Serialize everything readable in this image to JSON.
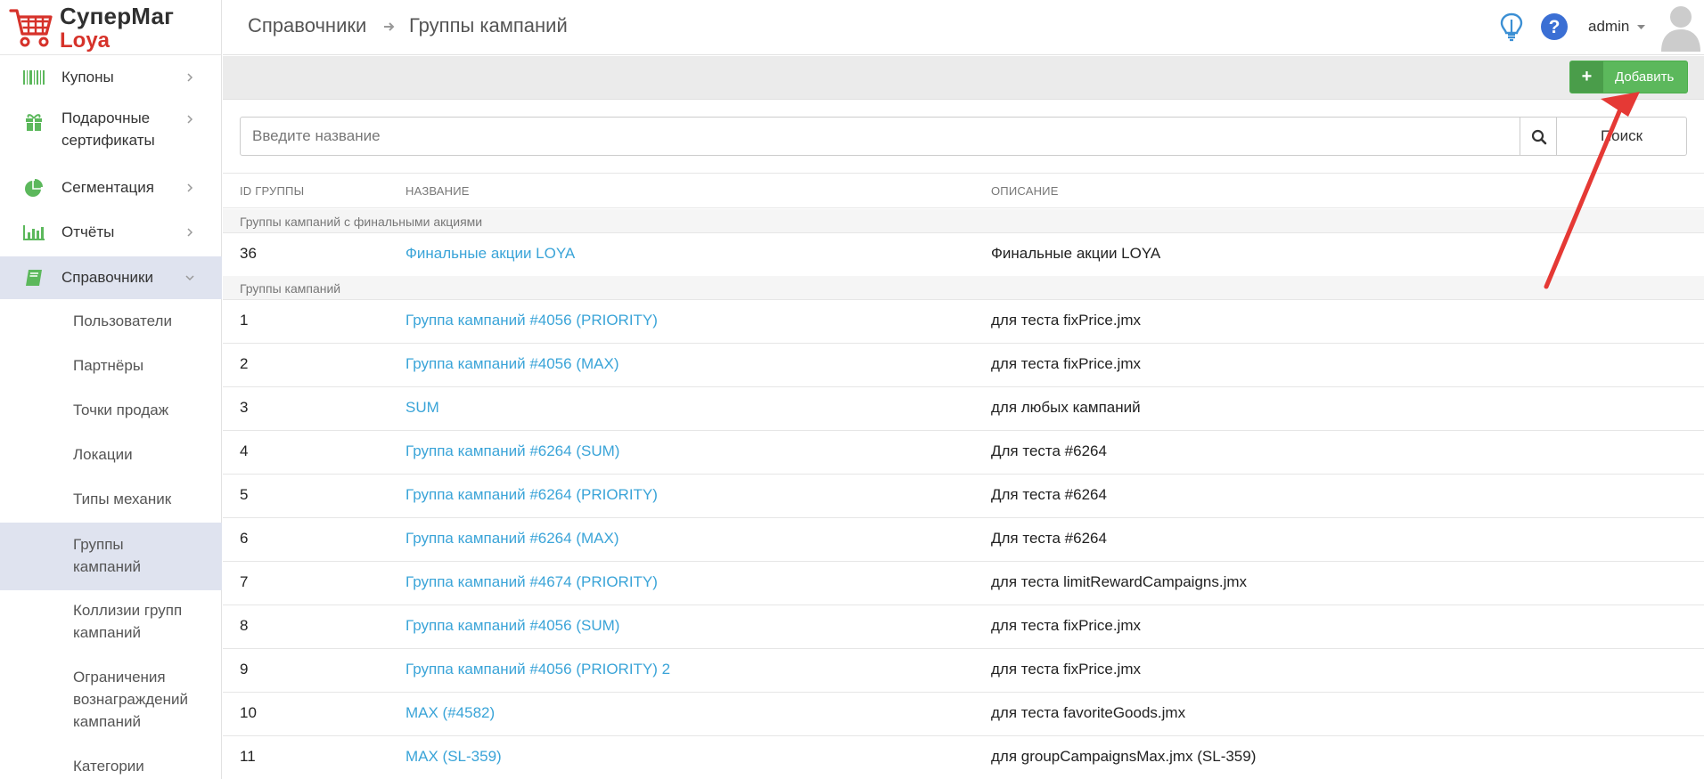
{
  "brand": {
    "title": "СуперМаг",
    "subtitle": "Loya",
    "accent_red": "#d6322a",
    "link_blue": "#3aa4d8",
    "button_green": "#5cb85c"
  },
  "sidebar": {
    "items": [
      {
        "label": "Купоны",
        "icon": "barcode-icon"
      },
      {
        "label": "Подарочные сертификаты",
        "icon": "gift-icon"
      },
      {
        "label": "Сегментация",
        "icon": "pie-chart-icon"
      },
      {
        "label": "Отчёты",
        "icon": "bar-chart-icon"
      },
      {
        "label": "Справочники",
        "icon": "book-icon",
        "active": true
      }
    ],
    "subitems": [
      {
        "label": "Пользователи"
      },
      {
        "label": "Партнёры"
      },
      {
        "label": "Точки продаж"
      },
      {
        "label": "Локации"
      },
      {
        "label": "Типы механик"
      },
      {
        "label": "Группы кампаний",
        "active": true
      },
      {
        "label": "Коллизии групп кампаний"
      },
      {
        "label": "Ограничения вознаграждений кампаний"
      },
      {
        "label": "Категории"
      }
    ]
  },
  "header": {
    "breadcrumb": [
      "Справочники",
      "Группы кампаний"
    ],
    "user": "admin"
  },
  "toolbar": {
    "add_label": "Добавить",
    "add_icon": "plus-icon"
  },
  "search": {
    "placeholder": "Введите название",
    "value": "",
    "button_label": "Поиск"
  },
  "table": {
    "columns": [
      "ID группы",
      "Название",
      "Описание"
    ],
    "sections": [
      {
        "title": "Группы кампаний с финальными акциями",
        "rows": [
          {
            "id": "36",
            "name": "Финальные акции LOYA",
            "description": "Финальные акции LOYA"
          }
        ]
      },
      {
        "title": "Группы кампаний",
        "rows": [
          {
            "id": "1",
            "name": "Группа кампаний #4056 (PRIORITY)",
            "description": "для теста fixPrice.jmx"
          },
          {
            "id": "2",
            "name": "Группа кампаний #4056 (MAX)",
            "description": "для теста fixPrice.jmx"
          },
          {
            "id": "3",
            "name": "SUM",
            "description": "для любых кампаний"
          },
          {
            "id": "4",
            "name": "Группа кампаний #6264 (SUM)",
            "description": "Для теста #6264"
          },
          {
            "id": "5",
            "name": "Группа кампаний #6264 (PRIORITY)",
            "description": "Для теста #6264"
          },
          {
            "id": "6",
            "name": "Группа кампаний #6264 (MAX)",
            "description": "Для теста #6264"
          },
          {
            "id": "7",
            "name": "Группа кампаний #4674 (PRIORITY)",
            "description": "для теста limitRewardCampaigns.jmx"
          },
          {
            "id": "8",
            "name": "Группа кампаний #4056 (SUM)",
            "description": "для теста fixPrice.jmx"
          },
          {
            "id": "9",
            "name": "Группа кампаний #4056 (PRIORITY) 2",
            "description": "для теста fixPrice.jmx"
          },
          {
            "id": "10",
            "name": "MAX (#4582)",
            "description": "для теста favoriteGoods.jmx"
          },
          {
            "id": "11",
            "name": "MAX (SL-359)",
            "description": "для groupCampaignsMax.jmx (SL-359)"
          }
        ]
      }
    ]
  }
}
